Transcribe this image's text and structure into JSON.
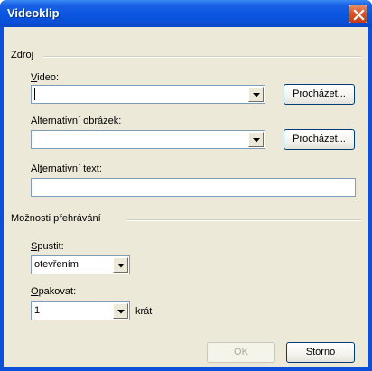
{
  "window": {
    "title": "Videoklip"
  },
  "source_group": {
    "title": "Zdroj",
    "video": {
      "label_key": "V",
      "label_rest": "ideo:",
      "value": "",
      "browse_label": "Procházet..."
    },
    "alt_image": {
      "label_key": "A",
      "label_rest": "lternativní obrázek:",
      "value": "",
      "browse_label": "Procházet..."
    },
    "alt_text": {
      "label_pre": "Al",
      "label_key": "t",
      "label_rest": "ernativní text:",
      "value": ""
    }
  },
  "playback_group": {
    "title": "Možnosti přehrávání",
    "start": {
      "label_key": "S",
      "label_rest": "pustit:",
      "value": "otevřením"
    },
    "repeat": {
      "label_key": "O",
      "label_rest": "pakovat:",
      "value": "1",
      "suffix": "krát"
    }
  },
  "footer": {
    "ok_label": "OK",
    "cancel_label": "Storno"
  },
  "icons": {
    "close": "close-icon",
    "dropdown": "chevron-down-icon"
  },
  "colors": {
    "titlebar": "#0a55e0",
    "client": "#ece9d8",
    "close": "#d9522a"
  }
}
